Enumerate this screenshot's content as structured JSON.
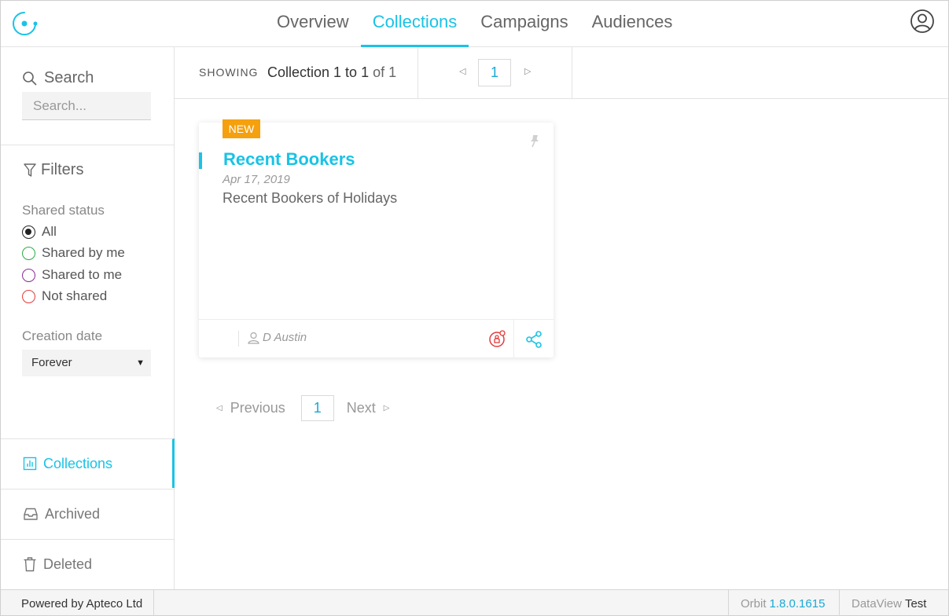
{
  "nav": {
    "tabs": [
      {
        "label": "Overview",
        "active": false
      },
      {
        "label": "Collections",
        "active": true
      },
      {
        "label": "Campaigns",
        "active": false
      },
      {
        "label": "Audiences",
        "active": false
      }
    ]
  },
  "sidebar": {
    "search_title": "Search",
    "search_placeholder": "Search...",
    "filters_title": "Filters",
    "shared_status_label": "Shared status",
    "shared_options": [
      {
        "label": "All",
        "checked": true,
        "color": "#222222"
      },
      {
        "label": "Shared by me",
        "checked": false,
        "color": "#2eaa4a"
      },
      {
        "label": "Shared to me",
        "checked": false,
        "color": "#8a2b9a"
      },
      {
        "label": "Not shared",
        "checked": false,
        "color": "#e33b3b"
      }
    ],
    "creation_date_label": "Creation date",
    "creation_date_value": "Forever",
    "nav_items": [
      {
        "label": "Collections",
        "icon": "chart-icon",
        "active": true
      },
      {
        "label": "Archived",
        "icon": "inbox-icon",
        "active": false
      },
      {
        "label": "Deleted",
        "icon": "trash-icon",
        "active": false
      }
    ]
  },
  "main": {
    "showing_label": "SHOWING",
    "showing_prefix": "Collection 1 to 1",
    "showing_suffix": "of 1",
    "current_page": "1",
    "card": {
      "badge": "NEW",
      "title": "Recent Bookers",
      "date": "Apr 17, 2019",
      "description": "Recent Bookers of Holidays",
      "author": "D Austin"
    },
    "pager": {
      "previous": "Previous",
      "page": "1",
      "next": "Next"
    }
  },
  "footer": {
    "powered_by": "Powered by Apteco Ltd",
    "orbit_label": "Orbit",
    "orbit_version": "1.8.0.1615",
    "dataview_label": "DataView",
    "dataview_env": "Test"
  },
  "colors": {
    "accent": "#19c3e6",
    "badge": "#f5a00f"
  }
}
